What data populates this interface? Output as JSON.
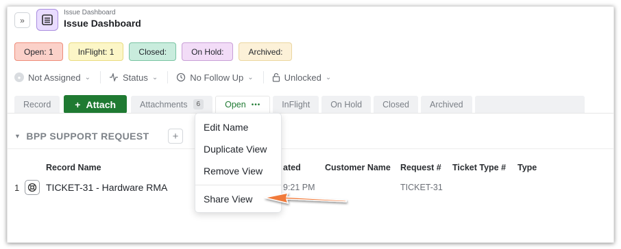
{
  "header": {
    "collapse_icon": "»",
    "breadcrumb": "Issue Dashboard",
    "title": "Issue Dashboard"
  },
  "status_pills": [
    {
      "label": "Open: 1",
      "bg": "#fbd1c9",
      "border": "#ee8b78"
    },
    {
      "label": "InFlight: 1",
      "bg": "#fcf6c7",
      "border": "#e9db7f"
    },
    {
      "label": "Closed:",
      "bg": "#c9ecdd",
      "border": "#78c3a2"
    },
    {
      "label": "On Hold:",
      "bg": "#f2dcf7",
      "border": "#c89ed6"
    },
    {
      "label": "Archived:",
      "bg": "#fcf1d8",
      "border": "#ebd69f"
    }
  ],
  "filters": {
    "assignee": "Not Assigned",
    "status": "Status",
    "follow_up": "No Follow Up",
    "lock": "Unlocked"
  },
  "tabs": {
    "record": "Record",
    "attach": "Attach",
    "attachments": "Attachments",
    "attachments_count": "6",
    "open": "Open",
    "open_more": "•••",
    "inflight": "InFlight",
    "on_hold": "On Hold",
    "closed": "Closed",
    "archived": "Archived"
  },
  "section": {
    "title": "BPP SUPPORT REQUEST",
    "add": "+"
  },
  "table": {
    "headers": {
      "record_name": "Record Name",
      "created": "ated",
      "customer_name": "Customer Name",
      "request_no": "Request #",
      "ticket_type_no": "Ticket Type #",
      "type": "Type"
    },
    "rows": [
      {
        "num": "1",
        "name": "TICKET-31 - Hardware RMA",
        "created": "9:21 PM",
        "customer": "",
        "request_no": "TICKET-31",
        "ticket_type": "",
        "type": ""
      }
    ]
  },
  "menu": {
    "items": [
      "Edit Name",
      "Duplicate View",
      "Remove View",
      "Share View"
    ]
  },
  "colors": {
    "accent_green": "#1f7a32",
    "arrow_orange": "#f07a3a"
  }
}
